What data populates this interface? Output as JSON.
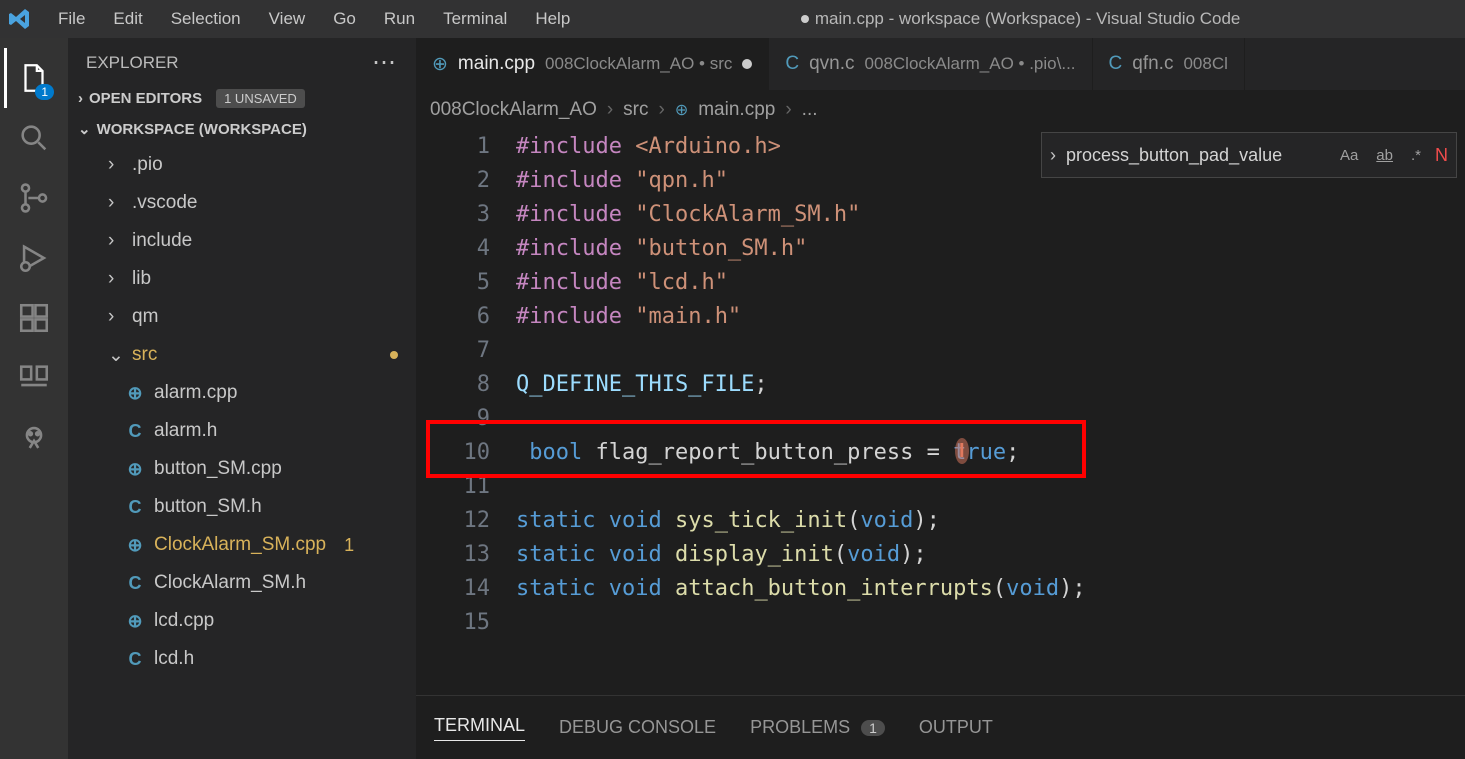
{
  "titlebar": {
    "title": "main.cpp - workspace (Workspace) - Visual Studio Code",
    "menus": [
      "File",
      "Edit",
      "Selection",
      "View",
      "Go",
      "Run",
      "Terminal",
      "Help"
    ]
  },
  "activitybar": {
    "explorer_badge": "1"
  },
  "sidebar": {
    "header": "EXPLORER",
    "open_editors_label": "OPEN EDITORS",
    "unsaved_label": "1 UNSAVED",
    "workspace_label": "WORKSPACE (WORKSPACE)",
    "folders": [
      {
        "name": ".pio",
        "expanded": false
      },
      {
        "name": ".vscode",
        "expanded": false
      },
      {
        "name": "include",
        "expanded": false
      },
      {
        "name": "lib",
        "expanded": false
      },
      {
        "name": "qm",
        "expanded": false
      }
    ],
    "src_folder": {
      "name": "src",
      "expanded": true,
      "modified": true
    },
    "files": [
      {
        "name": "alarm.cpp",
        "icon": "cpp"
      },
      {
        "name": "alarm.h",
        "icon": "c"
      },
      {
        "name": "button_SM.cpp",
        "icon": "cpp"
      },
      {
        "name": "button_SM.h",
        "icon": "c"
      },
      {
        "name": "ClockAlarm_SM.cpp",
        "icon": "cpp",
        "warn": true,
        "problems": "1"
      },
      {
        "name": "ClockAlarm_SM.h",
        "icon": "c"
      },
      {
        "name": "lcd.cpp",
        "icon": "cpp"
      },
      {
        "name": "lcd.h",
        "icon": "c"
      }
    ]
  },
  "tabs": [
    {
      "icon": "cpp",
      "name": "main.cpp",
      "path": "008ClockAlarm_AO • src",
      "active": true,
      "dirty": true
    },
    {
      "icon": "c",
      "name": "qvn.c",
      "path": "008ClockAlarm_AO • .pio\\...",
      "active": false
    },
    {
      "icon": "c",
      "name": "qfn.c",
      "path": "008Cl",
      "active": false
    }
  ],
  "breadcrumbs": {
    "parts": [
      "008ClockAlarm_AO",
      "src",
      "main.cpp",
      "..."
    ],
    "file_icon": "cpp"
  },
  "find": {
    "text": "process_button_pad_value",
    "opt_case": "Aa",
    "opt_word": "ab",
    "opt_regex": ".*",
    "no_results": "N"
  },
  "code": {
    "lines": [
      {
        "n": "1",
        "tokens": [
          [
            "pp",
            "#include "
          ],
          [
            "str",
            "<Arduino.h>"
          ]
        ]
      },
      {
        "n": "2",
        "tokens": [
          [
            "pp",
            "#include "
          ],
          [
            "str",
            "\"qpn.h\""
          ]
        ]
      },
      {
        "n": "3",
        "tokens": [
          [
            "pp",
            "#include "
          ],
          [
            "str",
            "\"ClockAlarm_SM.h\""
          ]
        ]
      },
      {
        "n": "4",
        "tokens": [
          [
            "pp",
            "#include "
          ],
          [
            "str",
            "\"button_SM.h\""
          ]
        ]
      },
      {
        "n": "5",
        "tokens": [
          [
            "pp",
            "#include "
          ],
          [
            "str",
            "\"lcd.h\""
          ]
        ]
      },
      {
        "n": "6",
        "tokens": [
          [
            "pp",
            "#include "
          ],
          [
            "str",
            "\"main.h\""
          ]
        ]
      },
      {
        "n": "7",
        "tokens": []
      },
      {
        "n": "8",
        "tokens": [
          [
            "id",
            "Q_DEFINE_THIS_FILE"
          ],
          [
            "punc",
            ";"
          ]
        ]
      },
      {
        "n": "9",
        "tokens": []
      },
      {
        "n": "10",
        "tokens": [
          [
            "plain",
            " "
          ],
          [
            "kw",
            "bool"
          ],
          [
            "plain",
            " "
          ],
          [
            "plain",
            "flag_report_button_press "
          ],
          [
            "punc",
            "="
          ],
          [
            "plain",
            " "
          ],
          [
            "const",
            "true"
          ],
          [
            "punc",
            ";"
          ]
        ]
      },
      {
        "n": "11",
        "tokens": []
      },
      {
        "n": "12",
        "tokens": [
          [
            "kw",
            "static"
          ],
          [
            "plain",
            " "
          ],
          [
            "kw",
            "void"
          ],
          [
            "plain",
            " "
          ],
          [
            "fn",
            "sys_tick_init"
          ],
          [
            "punc",
            "("
          ],
          [
            "kw",
            "void"
          ],
          [
            "punc",
            ");"
          ]
        ]
      },
      {
        "n": "13",
        "tokens": [
          [
            "kw",
            "static"
          ],
          [
            "plain",
            " "
          ],
          [
            "kw",
            "void"
          ],
          [
            "plain",
            " "
          ],
          [
            "fn",
            "display_init"
          ],
          [
            "punc",
            "("
          ],
          [
            "kw",
            "void"
          ],
          [
            "punc",
            ");"
          ]
        ]
      },
      {
        "n": "14",
        "tokens": [
          [
            "kw",
            "static"
          ],
          [
            "plain",
            " "
          ],
          [
            "kw",
            "void"
          ],
          [
            "plain",
            " "
          ],
          [
            "fn",
            "attach_button_interrupts"
          ],
          [
            "punc",
            "("
          ],
          [
            "kw",
            "void"
          ],
          [
            "punc",
            ");"
          ]
        ]
      },
      {
        "n": "15",
        "tokens": []
      }
    ]
  },
  "panel": {
    "tabs": [
      "TERMINAL",
      "DEBUG CONSOLE",
      "PROBLEMS",
      "OUTPUT"
    ],
    "problems_badge": "1"
  }
}
